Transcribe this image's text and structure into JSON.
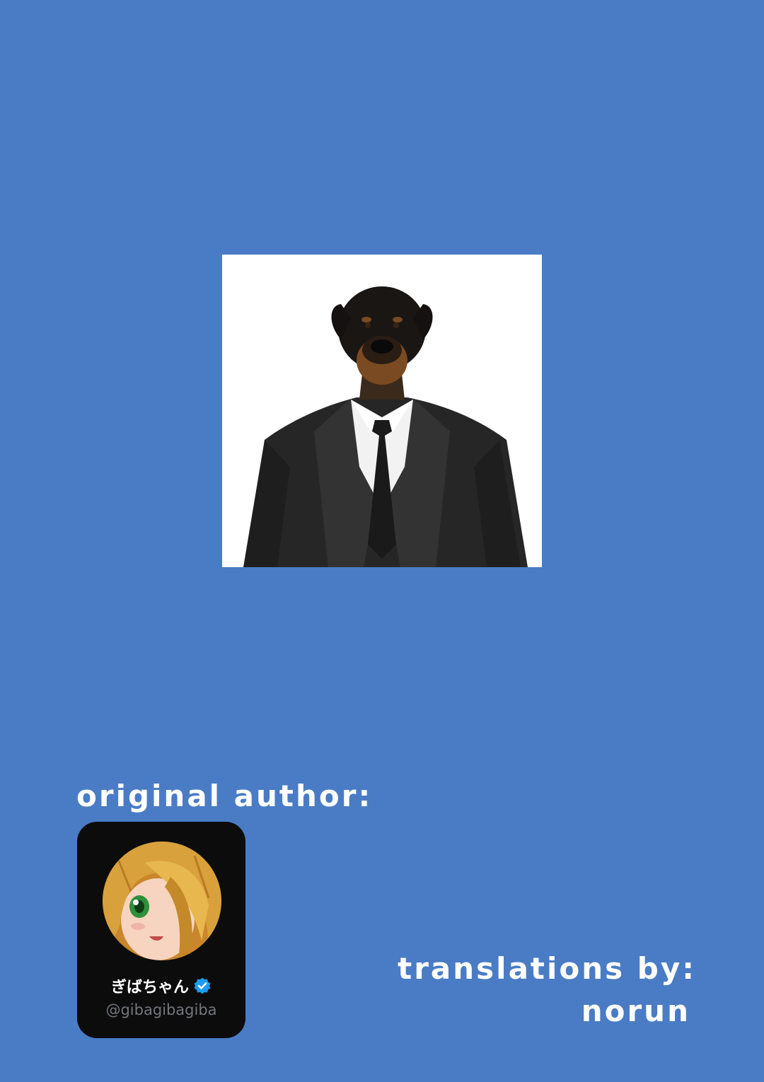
{
  "page": {
    "background_color": "#4a7cc5"
  },
  "portrait": {
    "icon": "dog-in-suit-image"
  },
  "credits": {
    "author_label": "original author:",
    "translations_label": "translations by:",
    "translator_name": "norun"
  },
  "author_card": {
    "display_name": "ぎばちゃん",
    "handle": "@gibagibagiba",
    "verified": true,
    "verified_color": "#1d9bf0",
    "avatar_icon": "anime-girl-avatar"
  }
}
